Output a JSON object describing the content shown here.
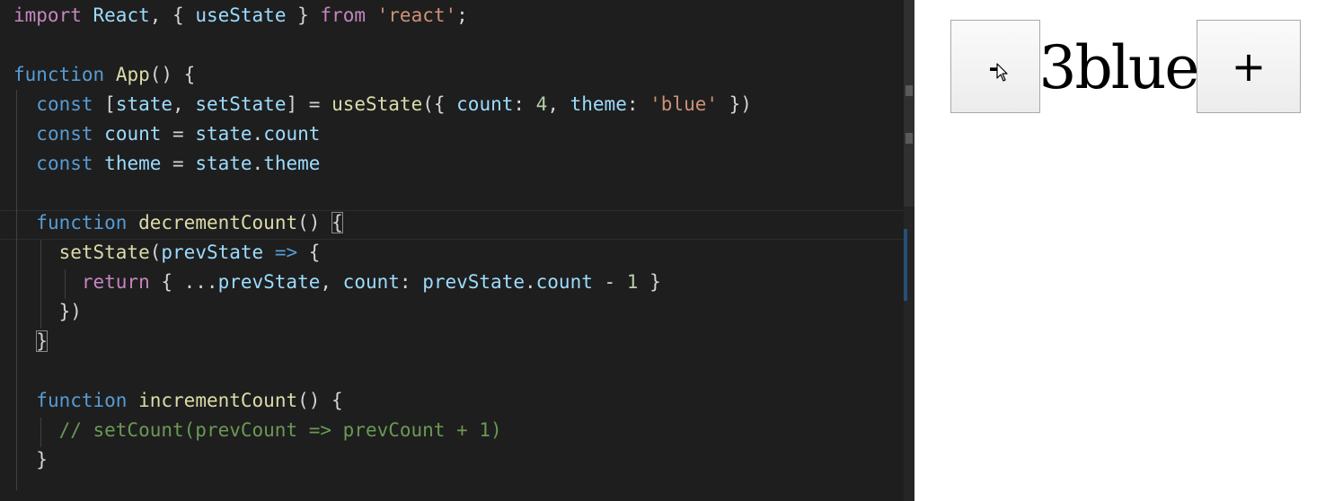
{
  "editor": {
    "lines": [
      [
        {
          "t": "import",
          "c": "kw"
        },
        {
          "t": " "
        },
        {
          "t": "React",
          "c": "var"
        },
        {
          "t": ", { "
        },
        {
          "t": "useState",
          "c": "var"
        },
        {
          "t": " } "
        },
        {
          "t": "from",
          "c": "kw"
        },
        {
          "t": " "
        },
        {
          "t": "'react'",
          "c": "str"
        },
        {
          "t": ";"
        }
      ],
      [],
      [
        {
          "t": "function",
          "c": "storage"
        },
        {
          "t": " "
        },
        {
          "t": "App",
          "c": "fn"
        },
        {
          "t": "() {"
        }
      ],
      [
        {
          "t": "  "
        },
        {
          "t": "const",
          "c": "storage"
        },
        {
          "t": " ["
        },
        {
          "t": "state",
          "c": "var"
        },
        {
          "t": ", "
        },
        {
          "t": "setState",
          "c": "var"
        },
        {
          "t": "] = "
        },
        {
          "t": "useState",
          "c": "fn"
        },
        {
          "t": "({ "
        },
        {
          "t": "count",
          "c": "var"
        },
        {
          "t": ": "
        },
        {
          "t": "4",
          "c": "num"
        },
        {
          "t": ", "
        },
        {
          "t": "theme",
          "c": "var"
        },
        {
          "t": ": "
        },
        {
          "t": "'blue'",
          "c": "str"
        },
        {
          "t": " })"
        }
      ],
      [
        {
          "t": "  "
        },
        {
          "t": "const",
          "c": "storage"
        },
        {
          "t": " "
        },
        {
          "t": "count",
          "c": "var"
        },
        {
          "t": " = "
        },
        {
          "t": "state",
          "c": "var"
        },
        {
          "t": "."
        },
        {
          "t": "count",
          "c": "var"
        }
      ],
      [
        {
          "t": "  "
        },
        {
          "t": "const",
          "c": "storage"
        },
        {
          "t": " "
        },
        {
          "t": "theme",
          "c": "var"
        },
        {
          "t": " = "
        },
        {
          "t": "state",
          "c": "var"
        },
        {
          "t": "."
        },
        {
          "t": "theme",
          "c": "var"
        }
      ],
      [],
      [
        {
          "t": "  "
        },
        {
          "t": "function",
          "c": "storage"
        },
        {
          "t": " "
        },
        {
          "t": "decrementCount",
          "c": "fn"
        },
        {
          "t": "() "
        },
        {
          "t": "{",
          "c": "brace"
        }
      ],
      [
        {
          "t": "    "
        },
        {
          "t": "setState",
          "c": "fn"
        },
        {
          "t": "("
        },
        {
          "t": "prevState",
          "c": "var"
        },
        {
          "t": " "
        },
        {
          "t": "=>",
          "c": "storage"
        },
        {
          "t": " {"
        }
      ],
      [
        {
          "t": "      "
        },
        {
          "t": "return",
          "c": "kw"
        },
        {
          "t": " { ..."
        },
        {
          "t": "prevState",
          "c": "var"
        },
        {
          "t": ", "
        },
        {
          "t": "count",
          "c": "var"
        },
        {
          "t": ": "
        },
        {
          "t": "prevState",
          "c": "var"
        },
        {
          "t": "."
        },
        {
          "t": "count",
          "c": "var"
        },
        {
          "t": " - "
        },
        {
          "t": "1",
          "c": "num"
        },
        {
          "t": " }"
        }
      ],
      [
        {
          "t": "    })"
        }
      ],
      [
        {
          "t": "  "
        },
        {
          "t": "}",
          "c": "brace"
        }
      ],
      [],
      [
        {
          "t": "  "
        },
        {
          "t": "function",
          "c": "storage"
        },
        {
          "t": " "
        },
        {
          "t": "incrementCount",
          "c": "fn"
        },
        {
          "t": "() {"
        }
      ],
      [
        {
          "t": "    "
        },
        {
          "t": "// setCount(prevCount => prevCount + 1)",
          "c": "comment"
        }
      ],
      [
        {
          "t": "  }"
        }
      ]
    ]
  },
  "preview": {
    "decrement_label": "-",
    "increment_label": "+",
    "count": "3",
    "theme": "blue"
  }
}
